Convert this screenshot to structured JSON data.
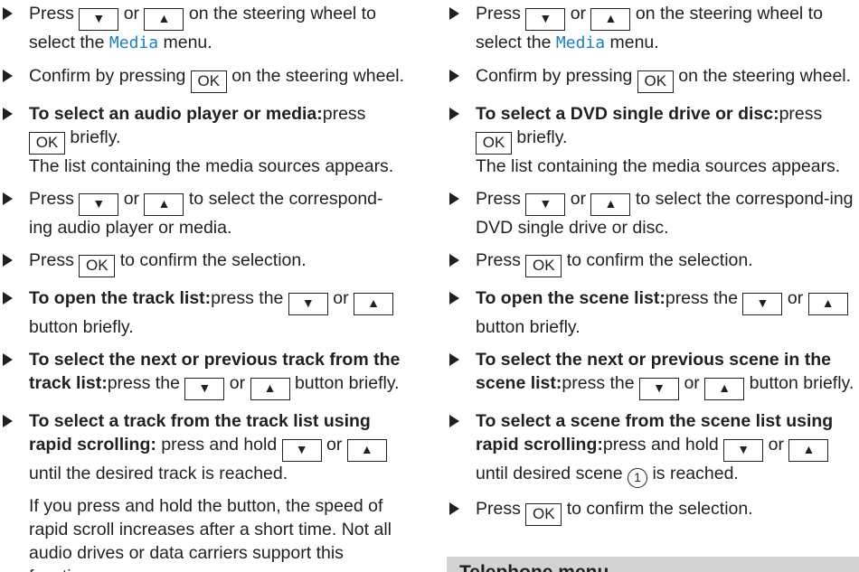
{
  "symbols": {
    "down": "▼",
    "up": "▲",
    "ok": "OK"
  },
  "left": {
    "s1": {
      "a": "Press",
      "b": "or",
      "c": "on the steering wheel to select the",
      "menu": "Media",
      "d": "menu."
    },
    "s2": {
      "a": "Confirm by pressing",
      "b": "on the steering wheel."
    },
    "s3": {
      "bold": "To select an audio player or media:",
      "a": "press",
      "b": "briefly.",
      "note": "The list containing the media sources appears."
    },
    "s4": {
      "a": "Press",
      "b": "or",
      "c": "to select the correspond-ing audio player or media."
    },
    "s5": {
      "a": "Press",
      "b": "to confirm the selection."
    },
    "s6": {
      "bold": "To open the track list:",
      "a": "press the",
      "b": "or",
      "c": "button briefly."
    },
    "s7": {
      "bold": "To select the next or previous track from the track list:",
      "a": "press the",
      "b": "or",
      "c": "button briefly."
    },
    "s8": {
      "bold": "To select a track from the track list using rapid scrolling:",
      "a": "press and hold",
      "b": "or",
      "c": "until the desired track is reached."
    },
    "note": "If you press and hold the button, the speed of rapid scroll increases after a short time. Not all audio drives or data carriers support this function."
  },
  "right": {
    "s1": {
      "a": "Press",
      "b": "or",
      "c": "on the steering wheel to select the",
      "menu": "Media",
      "d": "menu."
    },
    "s2": {
      "a": "Confirm by pressing",
      "b": "on the steering wheel."
    },
    "s3": {
      "bold": "To select a DVD single drive or disc:",
      "a": "press",
      "b": "briefly.",
      "note": "The list containing the media sources appears."
    },
    "s4": {
      "a": "Press",
      "b": "or",
      "c": "to select the correspond-ing DVD single drive or disc."
    },
    "s5": {
      "a": "Press",
      "b": "to confirm the selection."
    },
    "s6": {
      "bold": "To open the scene list:",
      "a": "press the",
      "b": "or",
      "c": "button briefly."
    },
    "s7": {
      "bold": "To select the next or previous scene in the scene list:",
      "a": "press the",
      "b": "or",
      "c": "button briefly."
    },
    "s8": {
      "bold": "To select a scene from the scene list using rapid scrolling:",
      "a": "press and hold",
      "b": "or",
      "c": "until desired scene",
      "num": "1",
      "d": "is reached."
    },
    "s9": {
      "a": "Press",
      "b": "to confirm the selection."
    },
    "section_title": "Telephone menu"
  }
}
